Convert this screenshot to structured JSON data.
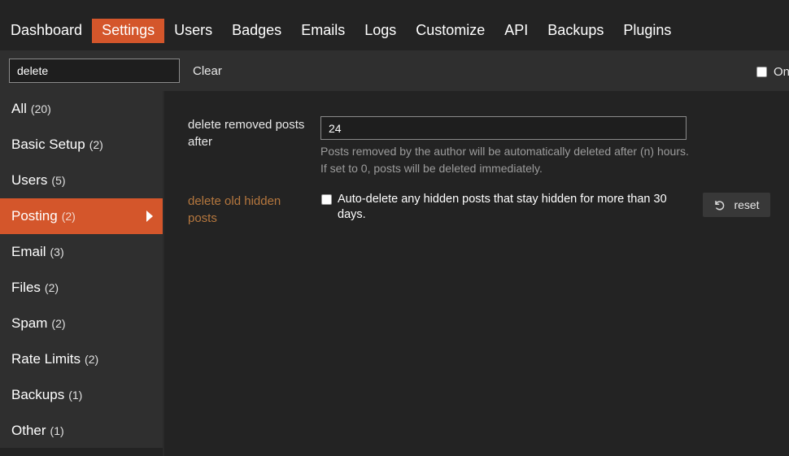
{
  "nav": {
    "items": [
      {
        "label": "Dashboard",
        "active": false
      },
      {
        "label": "Settings",
        "active": true
      },
      {
        "label": "Users",
        "active": false
      },
      {
        "label": "Badges",
        "active": false
      },
      {
        "label": "Emails",
        "active": false
      },
      {
        "label": "Logs",
        "active": false
      },
      {
        "label": "Customize",
        "active": false
      },
      {
        "label": "API",
        "active": false
      },
      {
        "label": "Backups",
        "active": false
      },
      {
        "label": "Plugins",
        "active": false
      }
    ]
  },
  "filter": {
    "value": "delete",
    "clear_label": "Clear",
    "only_overridden_label": "On"
  },
  "sidebar": {
    "items": [
      {
        "label": "All",
        "count": "(20)"
      },
      {
        "label": "Basic Setup",
        "count": "(2)"
      },
      {
        "label": "Users",
        "count": "(5)"
      },
      {
        "label": "Posting",
        "count": "(2)",
        "active": true
      },
      {
        "label": "Email",
        "count": "(3)"
      },
      {
        "label": "Files",
        "count": "(2)"
      },
      {
        "label": "Spam",
        "count": "(2)"
      },
      {
        "label": "Rate Limits",
        "count": "(2)"
      },
      {
        "label": "Backups",
        "count": "(1)"
      },
      {
        "label": "Other",
        "count": "(1)"
      }
    ]
  },
  "settings": {
    "removed_posts": {
      "label": "delete removed posts after",
      "value": "24",
      "description": "Posts removed by the author will be automatically deleted after (n) hours. If set to 0, posts will be deleted immediately."
    },
    "old_hidden": {
      "label": "delete old hidden posts",
      "checkbox_text": "Auto-delete any hidden posts that stay hidden for more than 30 days.",
      "reset_label": "reset"
    }
  },
  "colors": {
    "accent": "#d4562b",
    "overridden_label": "#b5773e",
    "background": "#232323",
    "panel": "#2f2f2f"
  }
}
